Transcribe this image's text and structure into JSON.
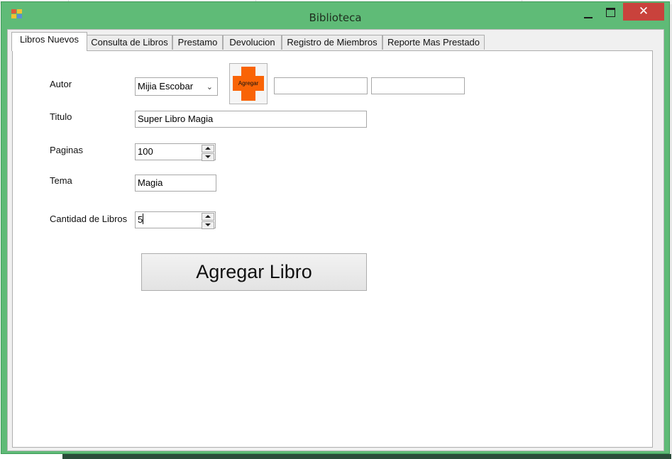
{
  "window": {
    "title": "Biblioteca",
    "close_glyph": "✕"
  },
  "tabs": [
    {
      "label": "Libros Nuevos",
      "active": true
    },
    {
      "label": "Consulta de Libros",
      "active": false
    },
    {
      "label": "Prestamo",
      "active": false
    },
    {
      "label": "Devolucion",
      "active": false
    },
    {
      "label": "Registro de Miembros",
      "active": false
    },
    {
      "label": "Reporte Mas Prestado",
      "active": false
    }
  ],
  "form": {
    "autor_label": "Autor",
    "autor_value": "Mijia Escobar",
    "autor_arrow": "⌄",
    "add_image_button_label": "Agregar",
    "extra_field_1_value": "",
    "extra_field_2_value": "",
    "titulo_label": "Titulo",
    "titulo_value": "Super Libro Magia",
    "paginas_label": "Paginas",
    "paginas_value": "100",
    "tema_label": "Tema",
    "tema_value": "Magia",
    "cantidad_label": "Cantidad de Libros",
    "cantidad_value": "5",
    "submit_label": "Agregar Libro"
  },
  "colors": {
    "window_frame": "#5fbb77",
    "close_button": "#c9423c",
    "add_icon_orange": "#f96406"
  },
  "icons": [
    "app-icon",
    "minimize-icon",
    "maximize-icon",
    "close-icon",
    "add-cross-icon",
    "dropdown-arrow-icon",
    "spin-up-icon",
    "spin-down-icon"
  ]
}
